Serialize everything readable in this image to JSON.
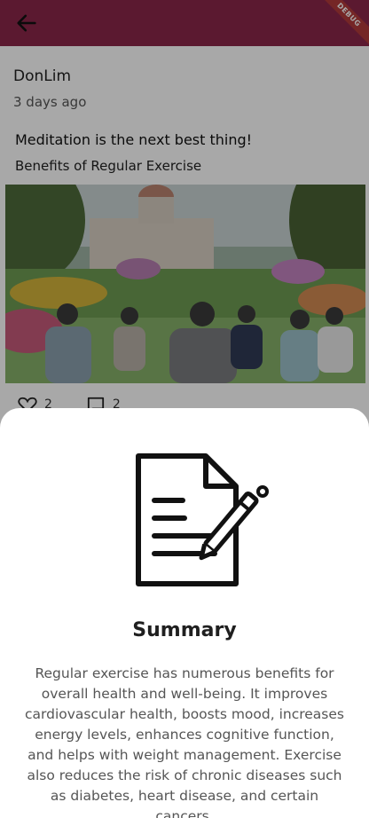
{
  "appbar": {
    "back_icon": "arrow-left-icon",
    "color": "#8a2749"
  },
  "debug_banner": {
    "label": "DEBUG"
  },
  "post": {
    "author": "DonLim",
    "time": "3 days ago",
    "title": "Meditation is the next best thing!",
    "subtitle": "Benefits of Regular Exercise",
    "image_alt": "Group meditating in a garden",
    "likes": "2",
    "comments": "2"
  },
  "sheet": {
    "icon": "document-pen-icon",
    "title": "Summary",
    "text": "Regular exercise has numerous benefits for overall health and well-being. It improves cardiovascular health, boosts mood, increases energy levels, enhances cognitive function, and helps with weight management. Exercise also reduces the risk of chronic diseases such as diabetes, heart disease, and certain cancers."
  }
}
